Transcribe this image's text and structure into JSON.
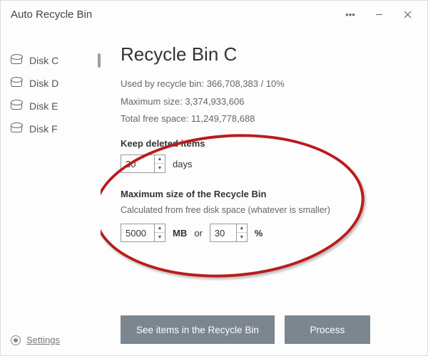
{
  "window": {
    "title": "Auto Recycle Bin"
  },
  "sidebar": {
    "items": [
      {
        "label": "Disk C",
        "active": true
      },
      {
        "label": "Disk D",
        "active": false
      },
      {
        "label": "Disk E",
        "active": false
      },
      {
        "label": "Disk F",
        "active": false
      }
    ],
    "settings_label": "Settings"
  },
  "main": {
    "title": "Recycle Bin C",
    "stats": {
      "used_label": "Used by recycle bin:",
      "used_value": "366,708,383 / 10%",
      "max_label": "Maximum size:",
      "max_value": "3,374,933,606",
      "free_label": "Total free space:",
      "free_value": "11,249,778,688"
    },
    "keep_section": {
      "label": "Keep deleted items",
      "days_value": "30",
      "days_unit": "days"
    },
    "size_section": {
      "label": "Maximum size of the Recycle Bin",
      "subtext": "Calculated from free disk space (whatever is smaller)",
      "mb_value": "5000",
      "mb_unit": "MB",
      "or_label": "or",
      "pct_value": "30",
      "pct_unit": "%"
    },
    "buttons": {
      "see_items": "See items in the Recycle Bin",
      "process": "Process"
    }
  }
}
